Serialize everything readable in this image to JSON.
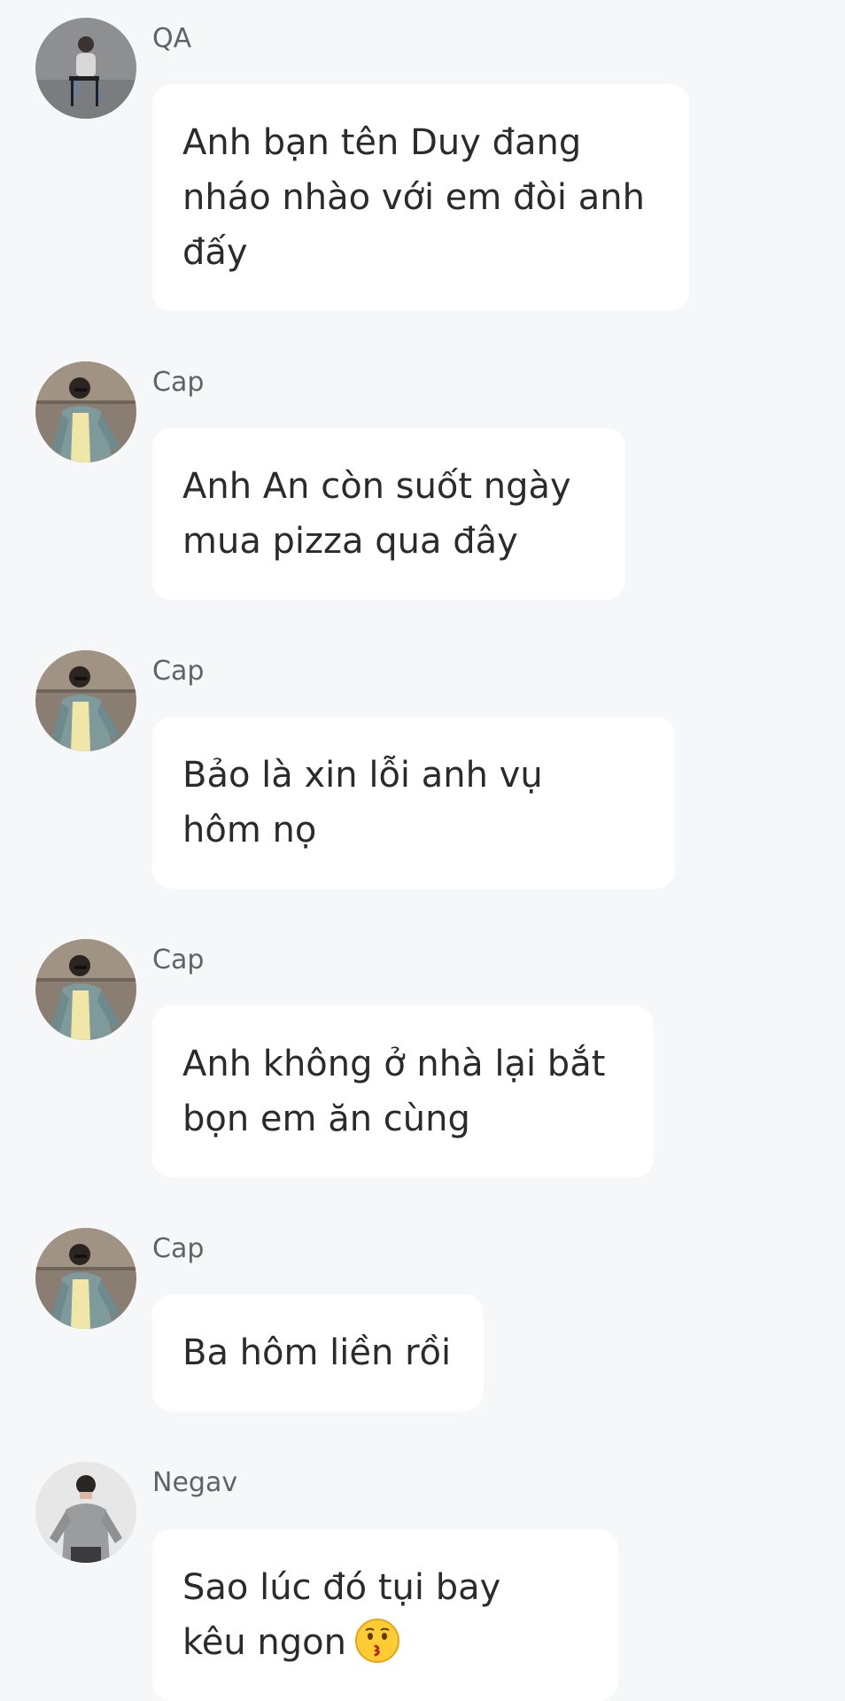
{
  "messages": [
    {
      "sender": "QA",
      "avatar": "avatar-qa-icon",
      "text": "Anh bạn tên Duy đang\nnháo nhào với em đòi anh\nđấy"
    },
    {
      "sender": "Cap",
      "avatar": "avatar-cap-icon",
      "text": "Anh An còn suốt ngày\nmua pizza qua đây"
    },
    {
      "sender": "Cap",
      "avatar": "avatar-cap-icon",
      "text": "Bảo là xin lỗi anh vụ\nhôm nọ"
    },
    {
      "sender": "Cap",
      "avatar": "avatar-cap-icon",
      "text": "Anh không ở nhà lại bắt\nbọn em ăn cùng"
    },
    {
      "sender": "Cap",
      "avatar": "avatar-cap-icon",
      "text": "Ba hôm liền rồi"
    },
    {
      "sender": "Negav",
      "avatar": "avatar-negav-icon",
      "text": "Sao lúc đó tụi bay\nkêu ngon",
      "emoji": "kissing-face-icon"
    }
  ],
  "colors": {
    "background": "#f6f7f9",
    "bubble": "#ffffff",
    "text": "#2b2b2b",
    "sender": "#5f6368"
  }
}
